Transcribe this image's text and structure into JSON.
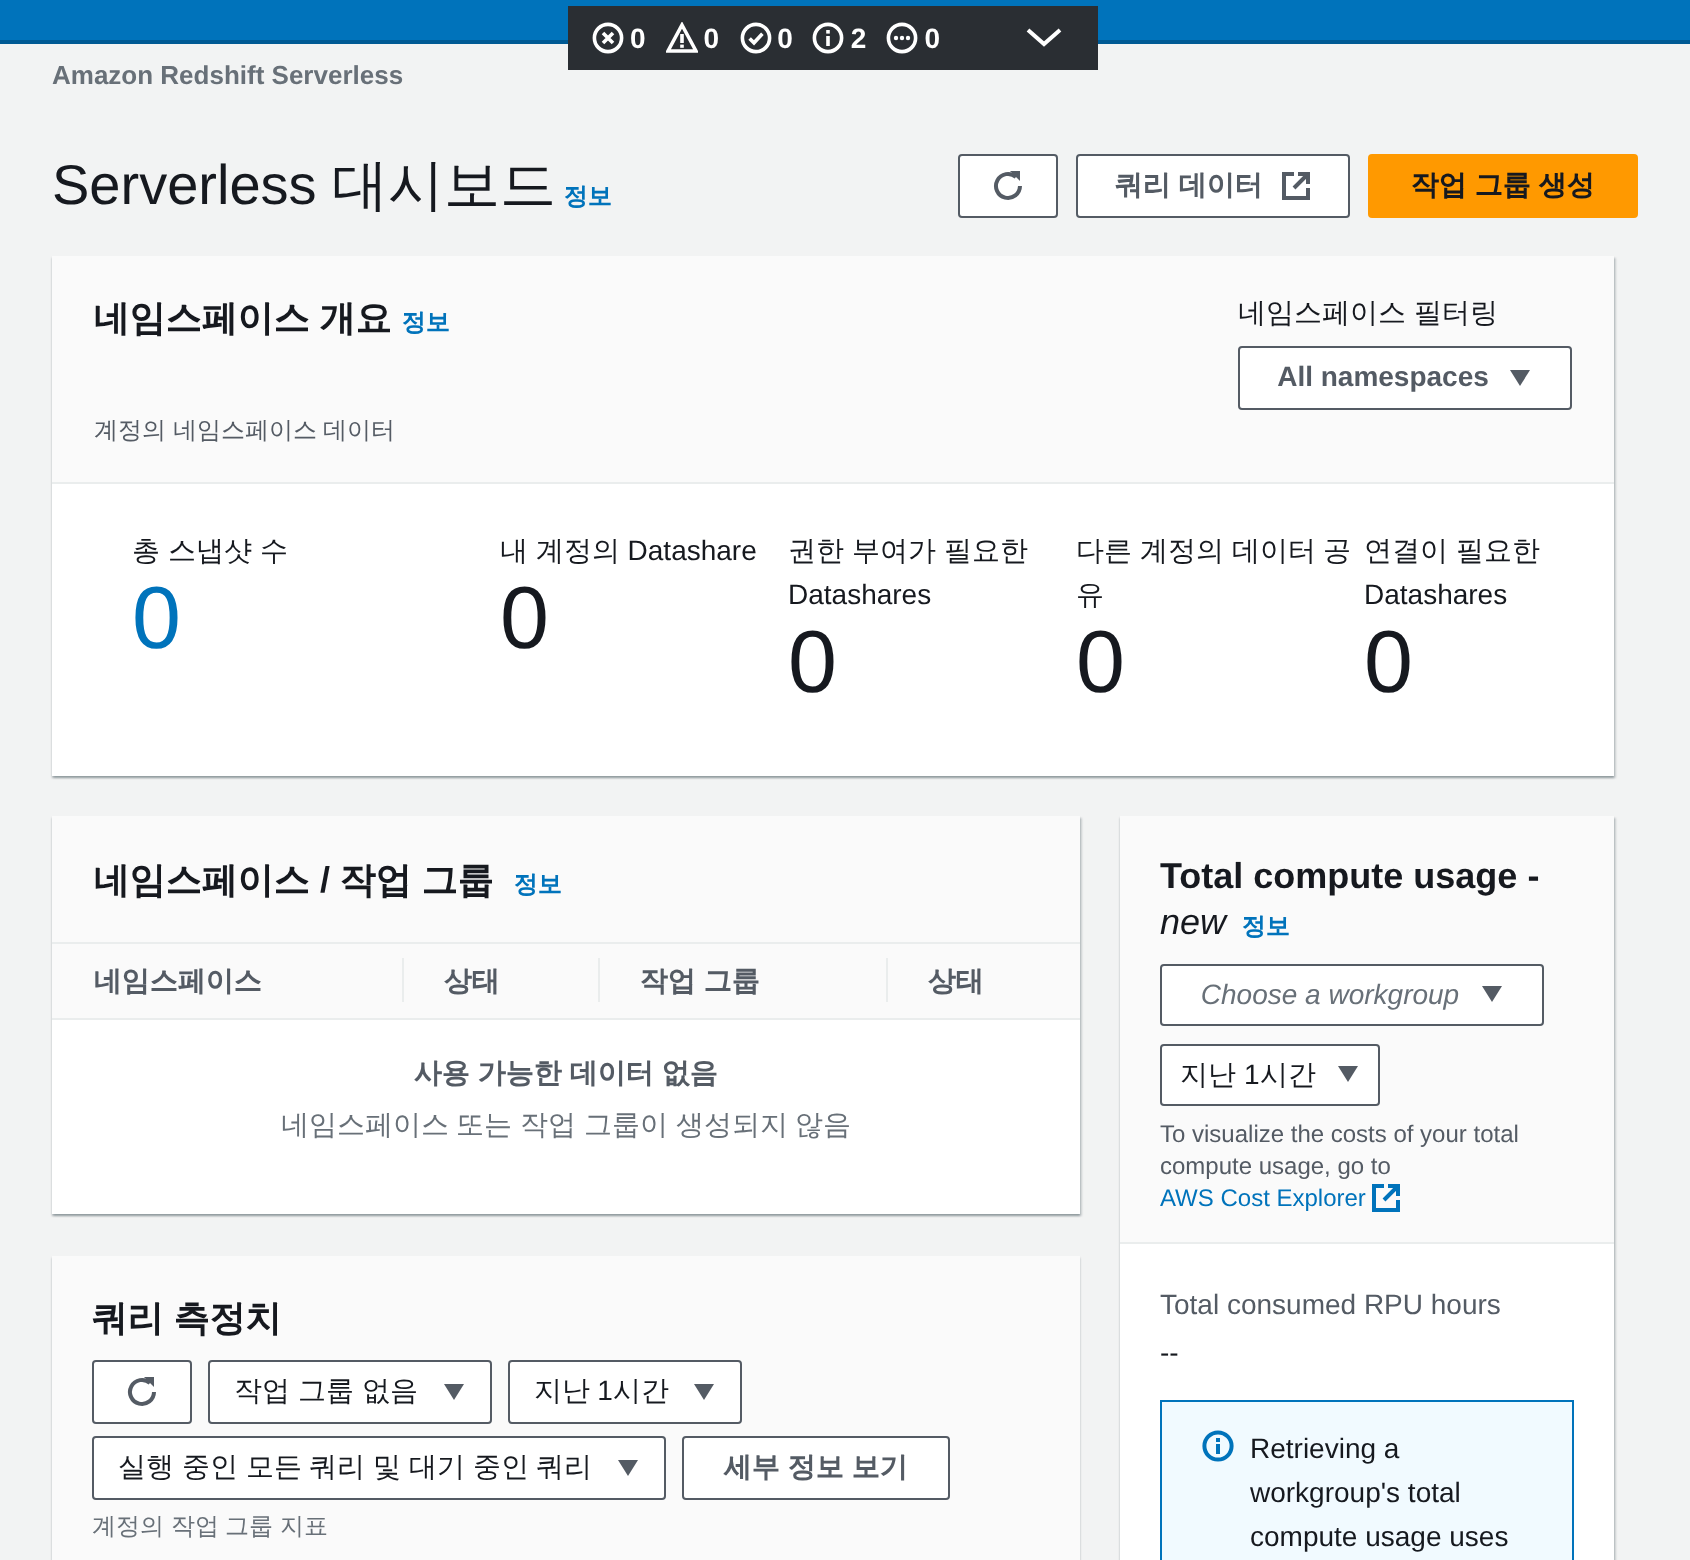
{
  "dev_toolbar": {
    "counters": [
      {
        "kind": "error",
        "count": "0"
      },
      {
        "kind": "warning",
        "count": "0"
      },
      {
        "kind": "success",
        "count": "0"
      },
      {
        "kind": "info",
        "count": "2"
      },
      {
        "kind": "other",
        "count": "0"
      }
    ]
  },
  "breadcrumb": "Amazon Redshift Serverless",
  "header": {
    "title": "Serverless 대시보드",
    "info": "정보",
    "buttons": [
      {
        "kind": "refresh"
      },
      {
        "kind": "external",
        "label": "쿼리 데이터"
      },
      {
        "kind": "primary",
        "label": "작업 그룹 생성"
      }
    ]
  },
  "namespace_overview": {
    "title": "네임스페이스 개요",
    "info": "정보",
    "description": "계정의 네임스페이스 데이터",
    "filter_label": "네임스페이스 필터링",
    "filter_value": "All namespaces",
    "metrics": [
      {
        "label": "총 스냅샷 수",
        "value": "0",
        "link": true
      },
      {
        "label": "내 계정의 Datashare",
        "value": "0",
        "link": false
      },
      {
        "label": "권한 부여가 필요한 Datashares",
        "value": "0",
        "link": false
      },
      {
        "label": "다른 계정의 데이터 공유",
        "value": "0",
        "link": false
      },
      {
        "label": "연결이 필요한 Datashares",
        "value": "0",
        "link": false
      }
    ]
  },
  "namespaces_workgroups": {
    "title": "네임스페이스 / 작업 그룹",
    "info": "정보",
    "columns": [
      "네임스페이스",
      "상태",
      "작업 그룹",
      "상태"
    ],
    "empty_title": "사용 가능한 데이터 없음",
    "empty_text": "네임스페이스 또는 작업 그룹이 생성되지 않음"
  },
  "query_metrics": {
    "title": "쿼리 측정치",
    "controls": [
      {
        "kind": "refresh"
      },
      {
        "kind": "dropdown",
        "label": "작업 그룹 없음"
      },
      {
        "kind": "dropdown",
        "label": "지난 1시간"
      },
      {
        "kind": "dropdown",
        "label": "실행 중인 모든 쿼리 및 대기 중인 쿼리"
      },
      {
        "kind": "button",
        "label": "세부 정보 보기"
      }
    ],
    "caption": "계정의 작업 그룹 지표"
  },
  "compute_usage": {
    "title": "Total compute usage -",
    "tag": "new",
    "info": "정보",
    "workgroup_placeholder": "Choose a workgroup",
    "time_range": "지난 1시간",
    "description": "To visualize the costs of your total compute usage, go to",
    "link": "AWS Cost Explorer",
    "metric_label": "Total consumed RPU hours",
    "metric_value": "--",
    "alert": "Retrieving a workgroup's total compute usage uses"
  }
}
